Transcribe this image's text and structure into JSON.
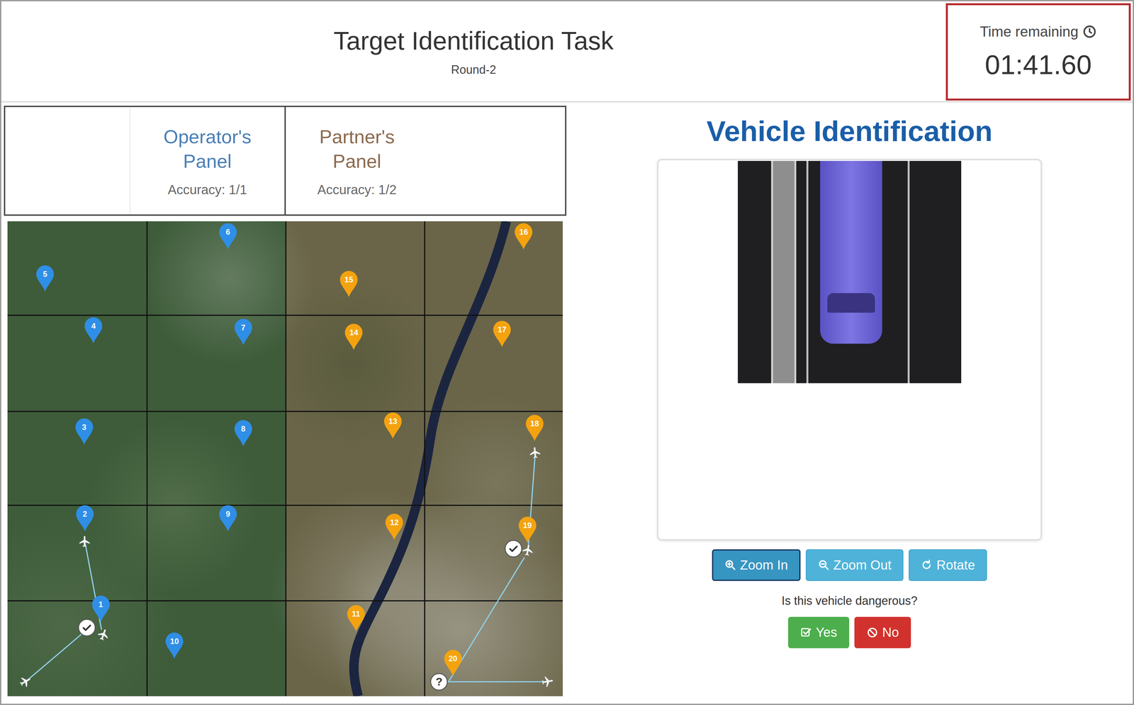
{
  "header": {
    "title": "Target Identification Task",
    "round": "Round-2"
  },
  "timer": {
    "label": "Time remaining",
    "value": "01:41.60"
  },
  "panels": [
    {
      "name": "Operator's Panel",
      "accuracy": "Accuracy: 1/1",
      "color": "#4a7fb5"
    },
    {
      "name": "Partner's Panel",
      "accuracy": "Accuracy: 1/2",
      "color": "#8b6a4e"
    }
  ],
  "map": {
    "pins": [
      {
        "label": "1",
        "color": "#2f8ee6",
        "checked": true
      },
      {
        "label": "2",
        "color": "#2f8ee6",
        "checked": false
      },
      {
        "label": "3",
        "color": "#2f8ee6",
        "checked": false
      },
      {
        "label": "4",
        "color": "#2f8ee6",
        "checked": false
      },
      {
        "label": "5",
        "color": "#2f8ee6",
        "checked": false
      },
      {
        "label": "6",
        "color": "#2f8ee6",
        "checked": false
      },
      {
        "label": "7",
        "color": "#2f8ee6",
        "checked": false
      },
      {
        "label": "8",
        "color": "#2f8ee6",
        "checked": false
      },
      {
        "label": "9",
        "color": "#2f8ee6",
        "checked": false
      },
      {
        "label": "10",
        "color": "#2f8ee6",
        "checked": false
      },
      {
        "label": "11",
        "color": "#f4a30f",
        "checked": false
      },
      {
        "label": "12",
        "color": "#f4a30f",
        "checked": false
      },
      {
        "label": "13",
        "color": "#f4a30f",
        "checked": false
      },
      {
        "label": "14",
        "color": "#f4a30f",
        "checked": false
      },
      {
        "label": "15",
        "color": "#f4a30f",
        "checked": false
      },
      {
        "label": "16",
        "color": "#f4a30f",
        "checked": false
      },
      {
        "label": "17",
        "color": "#f4a30f",
        "checked": false
      },
      {
        "label": "18",
        "color": "#f4a30f",
        "checked": false
      },
      {
        "label": "19",
        "color": "#f4a30f",
        "checked": true
      },
      {
        "label": "20",
        "color": "#f4a30f",
        "checked": false,
        "badge": "?"
      }
    ]
  },
  "vehicle": {
    "title": "Vehicle Identification",
    "tools": [
      {
        "label": "Zoom In",
        "kind": "zoom-in",
        "focused": true
      },
      {
        "label": "Zoom Out",
        "kind": "zoom-out",
        "focused": false
      },
      {
        "label": "Rotate",
        "kind": "rotate",
        "focused": false
      }
    ],
    "question": "Is this vehicle dangerous?",
    "answers": [
      {
        "label": "Yes",
        "kind": "yes",
        "color": "#4cae4c"
      },
      {
        "label": "No",
        "kind": "no",
        "color": "#d2322d"
      }
    ]
  }
}
